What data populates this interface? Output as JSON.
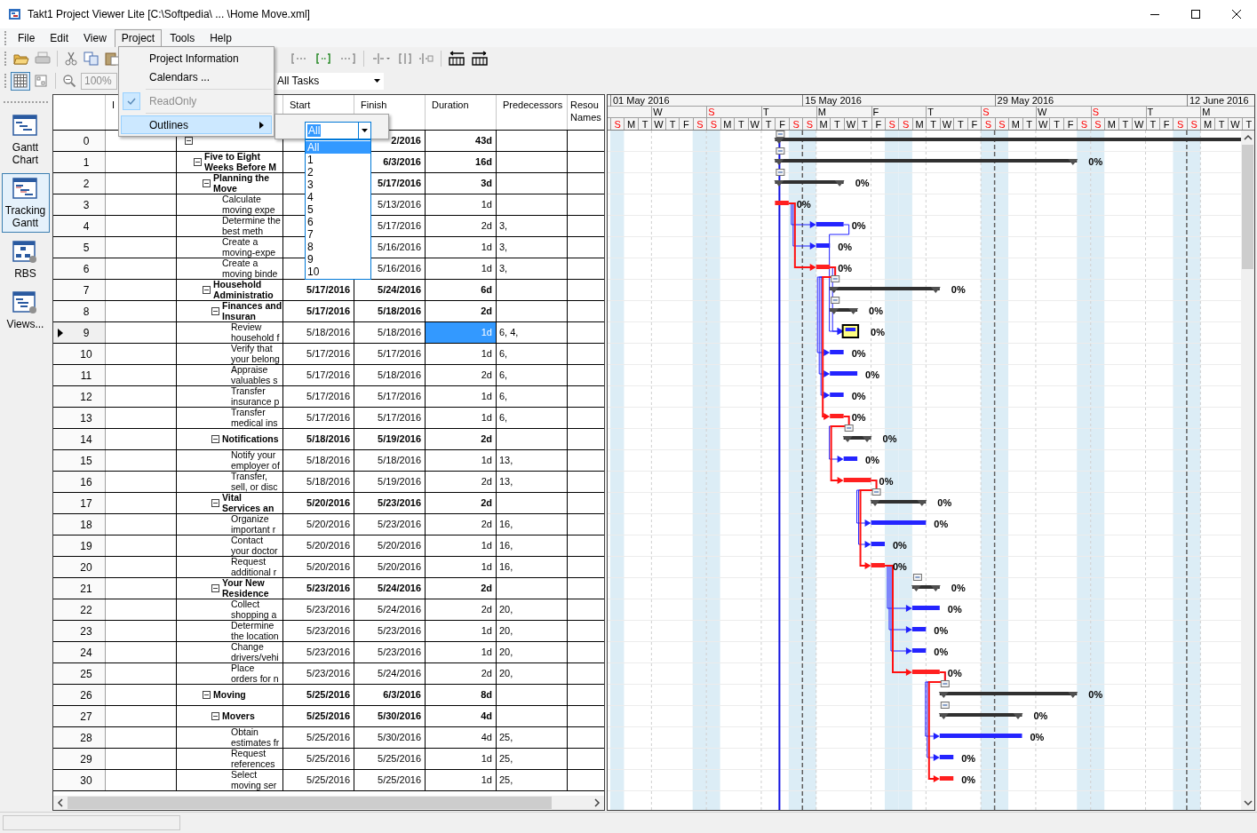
{
  "window": {
    "title": "Takt1 Project Viewer Lite [C:\\Softpedia\\ ... \\Home Move.xml]"
  },
  "menu_bar": [
    {
      "label": "File",
      "selected": false
    },
    {
      "label": "Edit",
      "selected": false
    },
    {
      "label": "View",
      "selected": false
    },
    {
      "label": "Project",
      "selected": true
    },
    {
      "label": "Tools",
      "selected": false
    },
    {
      "label": "Help",
      "selected": false
    }
  ],
  "toolbar": {
    "zoom": {
      "value": "100%",
      "disabled": true
    },
    "filter": {
      "value": "All Tasks"
    },
    "grid_view": {
      "pressed": true
    }
  },
  "views": [
    {
      "kind": "gantt",
      "label": "Gantt Chart",
      "selected": false
    },
    {
      "kind": "tracking",
      "label": "Tracking Gantt",
      "selected": true
    },
    {
      "kind": "rbs",
      "label": "RBS",
      "selected": false
    },
    {
      "kind": "views",
      "label": "Views...",
      "selected": false
    }
  ],
  "table": {
    "headers": {
      "indicators": "I",
      "start": "Start",
      "finish": "Finish",
      "duration": "Duration",
      "predecessors": "Predecessors",
      "resources": "Resou Names"
    },
    "tasks": [
      {
        "id": "0",
        "finish": "2/2016",
        "duration": "43d",
        "expanded": true,
        "selected": false,
        "children": [
          {
            "id": "1",
            "name": "Five to Eight Weeks Before M",
            "finish": "6/3/2016",
            "duration": "16d",
            "complete": "0%",
            "expanded": true,
            "selected": false,
            "children": [
              {
                "id": "2",
                "name": "Planning the Move",
                "finish": "5/17/2016",
                "duration": "3d",
                "complete": "0%",
                "expanded": true,
                "selected": false,
                "children": [
                  {
                    "id": "3",
                    "name": "Calculate moving expe",
                    "finish": "5/13/2016",
                    "duration": "1d",
                    "complete": "0%",
                    "critical": true,
                    "selected": false
                  },
                  {
                    "id": "4",
                    "name": "Determine the best meth",
                    "finish": "5/17/2016",
                    "duration": "2d",
                    "predecessors": "3,",
                    "complete": "0%",
                    "critical": false,
                    "selected": false
                  },
                  {
                    "id": "5",
                    "name": "Create a moving-expe",
                    "finish": "5/16/2016",
                    "duration": "1d",
                    "predecessors": "3,",
                    "complete": "0%",
                    "critical": false,
                    "selected": false
                  },
                  {
                    "id": "6",
                    "name": "Create a moving binde",
                    "finish": "5/16/2016",
                    "duration": "1d",
                    "predecessors": "3,",
                    "complete": "0%",
                    "critical": true,
                    "selected": false
                  }
                ]
              },
              {
                "id": "7",
                "name": "Household Administratio",
                "start": "5/17/2016",
                "finish": "5/24/2016",
                "duration": "6d",
                "complete": "0%",
                "expanded": true,
                "selected": false,
                "children": [
                  {
                    "id": "8",
                    "name": "Finances and Insuran",
                    "start": "5/17/2016",
                    "finish": "5/18/2016",
                    "duration": "2d",
                    "complete": "0%",
                    "expanded": true,
                    "selected": false,
                    "children": [
                      {
                        "id": "9",
                        "name": "Review household f",
                        "start": "5/18/2016",
                        "finish": "5/18/2016",
                        "duration": "1d",
                        "predecessors": "6, 4,",
                        "complete": "0%",
                        "critical": false,
                        "selected": true
                      },
                      {
                        "id": "10",
                        "name": "Verify that your belong",
                        "start": "5/17/2016",
                        "finish": "5/17/2016",
                        "duration": "1d",
                        "predecessors": "6,",
                        "complete": "0%",
                        "critical": false,
                        "selected": false
                      },
                      {
                        "id": "11",
                        "name": "Appraise valuables s",
                        "start": "5/17/2016",
                        "finish": "5/18/2016",
                        "duration": "2d",
                        "predecessors": "6,",
                        "complete": "0%",
                        "critical": false,
                        "selected": false
                      },
                      {
                        "id": "12",
                        "name": "Transfer insurance p",
                        "start": "5/17/2016",
                        "finish": "5/17/2016",
                        "duration": "1d",
                        "predecessors": "6,",
                        "complete": "0%",
                        "critical": false,
                        "selected": false
                      },
                      {
                        "id": "13",
                        "name": "Transfer medical ins",
                        "start": "5/17/2016",
                        "finish": "5/17/2016",
                        "duration": "1d",
                        "predecessors": "6,",
                        "complete": "0%",
                        "critical": true,
                        "selected": false
                      }
                    ]
                  },
                  {
                    "id": "14",
                    "name": "Notifications",
                    "start": "5/18/2016",
                    "finish": "5/19/2016",
                    "duration": "2d",
                    "complete": "0%",
                    "expanded": true,
                    "selected": false,
                    "children": [
                      {
                        "id": "15",
                        "name": "Notify your employer of",
                        "start": "5/18/2016",
                        "finish": "5/18/2016",
                        "duration": "1d",
                        "predecessors": "13,",
                        "complete": "0%",
                        "critical": false,
                        "selected": false
                      },
                      {
                        "id": "16",
                        "name": "Transfer, sell, or disc",
                        "start": "5/18/2016",
                        "finish": "5/19/2016",
                        "duration": "2d",
                        "predecessors": "13,",
                        "complete": "0%",
                        "critical": true,
                        "selected": false
                      }
                    ]
                  },
                  {
                    "id": "17",
                    "name": "Vital Services an",
                    "start": "5/20/2016",
                    "finish": "5/23/2016",
                    "duration": "2d",
                    "complete": "0%",
                    "expanded": true,
                    "selected": false,
                    "children": [
                      {
                        "id": "18",
                        "name": "Organize important r",
                        "start": "5/20/2016",
                        "finish": "5/23/2016",
                        "duration": "2d",
                        "predecessors": "16,",
                        "complete": "0%",
                        "critical": false,
                        "selected": false
                      },
                      {
                        "id": "19",
                        "name": "Contact your doctor",
                        "start": "5/20/2016",
                        "finish": "5/20/2016",
                        "duration": "1d",
                        "predecessors": "16,",
                        "complete": "0%",
                        "critical": false,
                        "selected": false
                      },
                      {
                        "id": "20",
                        "name": "Request additional r",
                        "start": "5/20/2016",
                        "finish": "5/20/2016",
                        "duration": "1d",
                        "predecessors": "16,",
                        "complete": "0%",
                        "critical": true,
                        "selected": false
                      }
                    ]
                  },
                  {
                    "id": "21",
                    "name": "Your New Residence",
                    "start": "5/23/2016",
                    "finish": "5/24/2016",
                    "duration": "2d",
                    "complete": "0%",
                    "expanded": true,
                    "selected": false,
                    "children": [
                      {
                        "id": "22",
                        "name": "Collect shopping a",
                        "start": "5/23/2016",
                        "finish": "5/24/2016",
                        "duration": "2d",
                        "predecessors": "20,",
                        "complete": "0%",
                        "critical": false,
                        "selected": false
                      },
                      {
                        "id": "23",
                        "name": "Determine the location",
                        "start": "5/23/2016",
                        "finish": "5/23/2016",
                        "duration": "1d",
                        "predecessors": "20,",
                        "complete": "0%",
                        "critical": false,
                        "selected": false
                      },
                      {
                        "id": "24",
                        "name": "Change drivers/vehi",
                        "start": "5/23/2016",
                        "finish": "5/23/2016",
                        "duration": "1d",
                        "predecessors": "20,",
                        "complete": "0%",
                        "critical": false,
                        "selected": false
                      },
                      {
                        "id": "25",
                        "name": "Place orders for n",
                        "start": "5/23/2016",
                        "finish": "5/24/2016",
                        "duration": "2d",
                        "predecessors": "20,",
                        "complete": "0%",
                        "critical": true,
                        "selected": false
                      }
                    ]
                  }
                ]
              },
              {
                "id": "26",
                "name": "Moving",
                "start": "5/25/2016",
                "finish": "6/3/2016",
                "duration": "8d",
                "complete": "0%",
                "expanded": true,
                "selected": false,
                "children": [
                  {
                    "id": "27",
                    "name": "Movers",
                    "start": "5/25/2016",
                    "finish": "5/30/2016",
                    "duration": "4d",
                    "complete": "0%",
                    "expanded": true,
                    "selected": false,
                    "children": [
                      {
                        "id": "28",
                        "name": "Obtain estimates fr",
                        "start": "5/25/2016",
                        "finish": "5/30/2016",
                        "duration": "4d",
                        "predecessors": "25,",
                        "complete": "0%",
                        "critical": false,
                        "selected": false
                      },
                      {
                        "id": "29",
                        "name": "Request references",
                        "start": "5/25/2016",
                        "finish": "5/25/2016",
                        "duration": "1d",
                        "predecessors": "25,",
                        "complete": "0%",
                        "critical": false,
                        "selected": false
                      },
                      {
                        "id": "30",
                        "name": "Select moving ser",
                        "start": "5/25/2016",
                        "finish": "5/25/2016",
                        "duration": "1d",
                        "predecessors": "25,",
                        "complete": "0%",
                        "critical": true,
                        "selected": false
                      }
                    ]
                  }
                ]
              }
            ]
          }
        ]
      }
    ]
  },
  "gantt": {
    "status_line": true,
    "months": [
      "01 May 2016",
      "15 May 2016",
      "29 May 2016",
      "12 June 2016"
    ],
    "weeks": [
      {
        "label": "W",
        "weekend": false
      },
      {
        "label": "S",
        "weekend": true
      },
      {
        "label": "T",
        "weekend": false
      },
      {
        "label": "M",
        "weekend": false
      },
      {
        "label": "F",
        "weekend": false
      },
      {
        "label": "T",
        "weekend": false
      },
      {
        "label": "S",
        "weekend": true
      },
      {
        "label": "W",
        "weekend": false
      },
      {
        "label": "S",
        "weekend": true
      },
      {
        "label": "T",
        "weekend": false
      },
      {
        "label": "M",
        "weekend": false
      }
    ],
    "days": [
      {
        "label": "S",
        "weekend": true
      },
      {
        "label": "M",
        "weekend": false
      },
      {
        "label": "T",
        "weekend": false
      },
      {
        "label": "W",
        "weekend": false
      },
      {
        "label": "T",
        "weekend": false
      },
      {
        "label": "F",
        "weekend": false
      },
      {
        "label": "S",
        "weekend": true
      },
      {
        "label": "S",
        "weekend": true
      },
      {
        "label": "M",
        "weekend": false
      },
      {
        "label": "T",
        "weekend": false
      },
      {
        "label": "W",
        "weekend": false
      },
      {
        "label": "T",
        "weekend": false
      },
      {
        "label": "F",
        "weekend": false
      },
      {
        "label": "S",
        "weekend": true
      },
      {
        "label": "S",
        "weekend": true
      },
      {
        "label": "M",
        "weekend": false
      },
      {
        "label": "T",
        "weekend": false
      },
      {
        "label": "W",
        "weekend": false
      },
      {
        "label": "T",
        "weekend": false
      },
      {
        "label": "F",
        "weekend": false
      },
      {
        "label": "S",
        "weekend": true
      },
      {
        "label": "S",
        "weekend": true
      },
      {
        "label": "M",
        "weekend": false
      },
      {
        "label": "T",
        "weekend": false
      },
      {
        "label": "W",
        "weekend": false
      },
      {
        "label": "T",
        "weekend": false
      },
      {
        "label": "F",
        "weekend": false
      },
      {
        "label": "S",
        "weekend": true
      },
      {
        "label": "S",
        "weekend": true
      },
      {
        "label": "M",
        "weekend": false
      },
      {
        "label": "T",
        "weekend": false
      },
      {
        "label": "W",
        "weekend": false
      },
      {
        "label": "T",
        "weekend": false
      },
      {
        "label": "F",
        "weekend": false
      },
      {
        "label": "S",
        "weekend": true
      },
      {
        "label": "S",
        "weekend": true
      },
      {
        "label": "M",
        "weekend": false
      },
      {
        "label": "T",
        "weekend": false
      },
      {
        "label": "W",
        "weekend": false
      },
      {
        "label": "T",
        "weekend": false
      },
      {
        "label": "F",
        "weekend": false
      },
      {
        "label": "S",
        "weekend": true
      },
      {
        "label": "S",
        "weekend": true
      },
      {
        "label": "M",
        "weekend": false
      },
      {
        "label": "T",
        "weekend": false
      },
      {
        "label": "W",
        "weekend": false
      },
      {
        "label": "T",
        "weekend": false
      }
    ]
  },
  "project_menu": [
    {
      "kind": "item",
      "label": "Project Information",
      "selected": false,
      "checked": false,
      "disabled": false
    },
    {
      "kind": "item",
      "label": "Calendars ...",
      "selected": false,
      "checked": false,
      "disabled": false
    },
    {
      "kind": "separator"
    },
    {
      "kind": "item",
      "label": "ReadOnly",
      "selected": false,
      "checked": true,
      "disabled": true
    },
    {
      "kind": "separator"
    },
    {
      "kind": "item",
      "label": "Outlines",
      "selected": true,
      "checked": false,
      "disabled": false,
      "submenu": {
        "value": "All",
        "options": [
          {
            "label": "All",
            "selected": true
          },
          {
            "label": "1",
            "selected": false
          },
          {
            "label": "2",
            "selected": false
          },
          {
            "label": "3",
            "selected": false
          },
          {
            "label": "4",
            "selected": false
          },
          {
            "label": "5",
            "selected": false
          },
          {
            "label": "6",
            "selected": false
          },
          {
            "label": "7",
            "selected": false
          },
          {
            "label": "8",
            "selected": false
          },
          {
            "label": "9",
            "selected": false
          },
          {
            "label": "10",
            "selected": false
          }
        ]
      }
    }
  ]
}
